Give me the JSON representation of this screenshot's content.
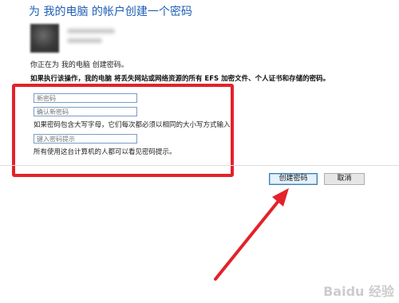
{
  "dialog": {
    "title": "为 我的电脑 的帐户创建一个密码",
    "description": "你正在为 我的电脑 创建密码。",
    "warning": "如果执行该操作，我的电脑 将丢失网站或网络资源的所有 EFS 加密文件、个人证书和存储的密码。"
  },
  "form": {
    "new_password_placeholder": "新密码",
    "confirm_password_placeholder": "确认新密码",
    "case_sensitive_note": "如果密码包含大写字母，它们每次都必须以相同的大小写方式输入。",
    "hint_placeholder": "键入密码提示",
    "hint_visibility_note": "所有使用这台计算机的人都可以看见密码提示。"
  },
  "buttons": {
    "create_label": "创建密码",
    "cancel_label": "取消"
  },
  "watermark": "Baidu 经验",
  "colors": {
    "title": "#1f5fb5",
    "highlight": "#e3222a",
    "arrow": "#e3222a"
  }
}
